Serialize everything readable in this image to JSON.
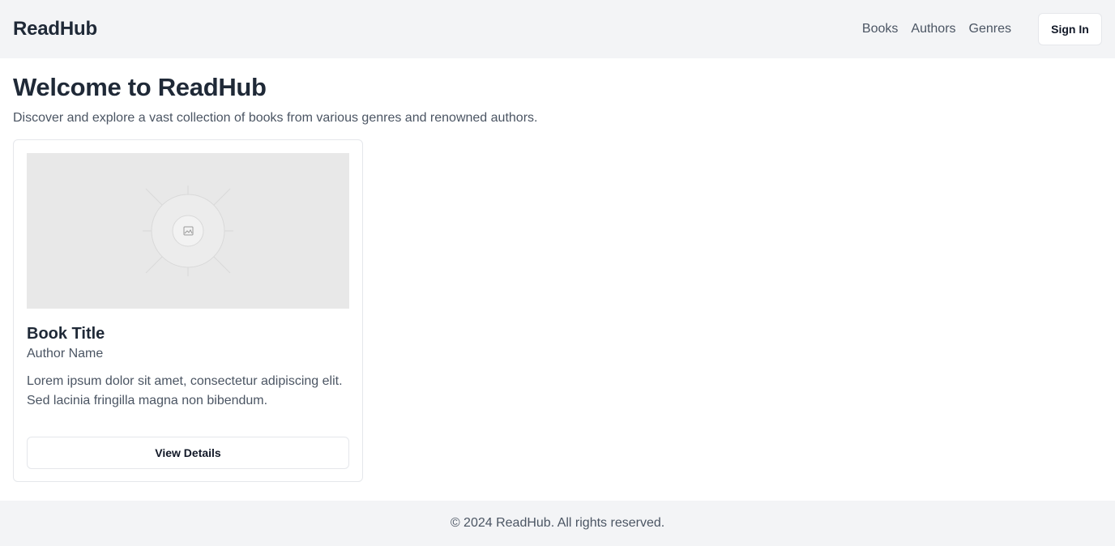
{
  "header": {
    "brand": "ReadHub",
    "nav": [
      "Books",
      "Authors",
      "Genres"
    ],
    "signin_label": "Sign In"
  },
  "main": {
    "title": "Welcome to ReadHub",
    "subtitle": "Discover and explore a vast collection of books from various genres and renowned authors.",
    "books": [
      {
        "title": "Book Title",
        "author": "Author Name",
        "description": "Lorem ipsum dolor sit amet, consectetur adipiscing elit. Sed lacinia fringilla magna non bibendum.",
        "button_label": "View Details",
        "cover_icon": "image-placeholder-icon"
      }
    ]
  },
  "footer": {
    "text": "© 2024 ReadHub. All rights reserved."
  },
  "colors": {
    "header_bg": "#f3f4f6",
    "text_primary": "#1f2937",
    "text_secondary": "#4b5563",
    "border": "#e5e7eb",
    "placeholder_bg": "#e8e8e8"
  }
}
